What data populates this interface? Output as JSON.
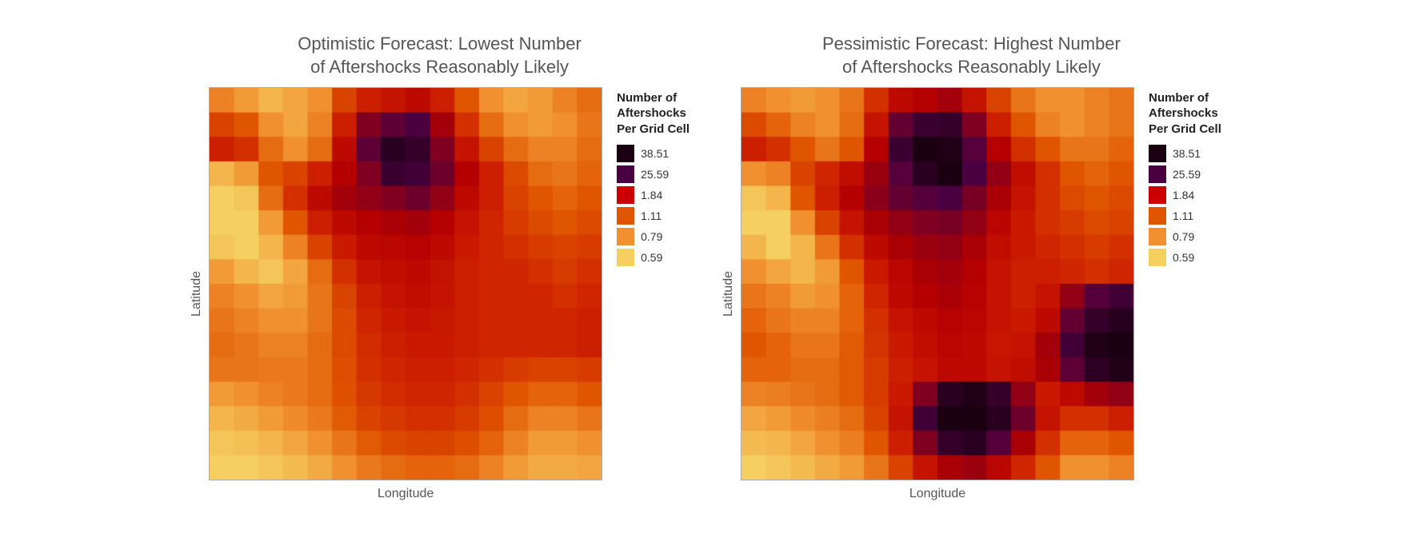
{
  "chart1": {
    "title": "Optimistic Forecast: Lowest Number\nof Aftershocks Reasonably Likely",
    "xLabel": "Longitude",
    "yLabel": "Latitude"
  },
  "chart2": {
    "title": "Pessimistic Forecast: Highest Number\nof Aftershocks Reasonably Likely",
    "xLabel": "Longitude",
    "yLabel": "Latitude"
  },
  "legend": {
    "title": "Number of\nAftershocks\nPer Grid Cell",
    "items": [
      {
        "value": "38.51",
        "color": "#1a0010"
      },
      {
        "value": "25.59",
        "color": "#4a0040"
      },
      {
        "value": "1.84",
        "color": "#cc0000"
      },
      {
        "value": "1.11",
        "color": "#e05500"
      },
      {
        "value": "0.79",
        "color": "#f09030"
      },
      {
        "value": "0.59",
        "color": "#f5d060"
      }
    ]
  }
}
